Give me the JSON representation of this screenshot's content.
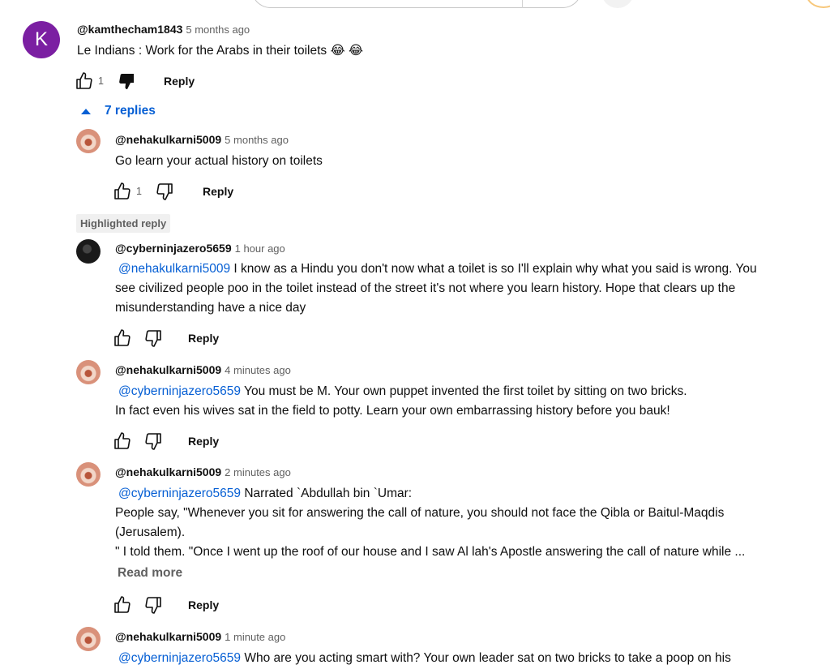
{
  "top_comment": {
    "avatar_letter": "K",
    "handle": "@kamthecham1843",
    "time": "5 months ago",
    "text": "Le Indians : Work for the Arabs in their toilets 😂 😂",
    "likes": "1",
    "reply_label": "Reply"
  },
  "replies_toggle": "7 replies",
  "highlight_label": "Highlighted reply",
  "replies": [
    {
      "handle": "@nehakulkarni5009",
      "time": "5 months ago",
      "lines": [
        "Go learn your actual history on toilets"
      ],
      "likes": "1",
      "reply_label": "Reply"
    },
    {
      "handle": "@cyberninjazero5659",
      "time": "1 hour ago",
      "mention": "@nehakulkarni5009",
      "lines": [
        " I know as a Hindu you don't now what a toilet is so I'll explain why what you said is wrong. You",
        "see civilized people poo in the toilet instead of the street it's not where you learn history. Hope that clears up the",
        "misunderstanding have a nice day"
      ],
      "reply_label": "Reply"
    },
    {
      "handle": "@nehakulkarni5009",
      "time": "4 minutes ago",
      "mention": "@cyberninjazero5659",
      "lines": [
        "  You must be M. Your own puppet invented the first toilet by sitting on two bricks.",
        "In fact even his wives sat in the field to potty. Learn your own embarrassing history before you bauk!"
      ],
      "reply_label": "Reply"
    },
    {
      "handle": "@nehakulkarni5009",
      "time": "2 minutes ago",
      "mention": "@cyberninjazero5659",
      "lines": [
        "  Narrated `Abdullah bin `Umar:",
        "People say, \"Whenever you sit for answering the call of nature, you should not face the Qibla or Baitul-Maqdis",
        "(Jerusalem).",
        "\" I told them. \"Once I went up the roof of our house and I saw Al lah's Apostle answering the call of nature while ..."
      ],
      "read_more": "Read more",
      "reply_label": "Reply"
    },
    {
      "handle": "@nehakulkarni5009",
      "time": "1 minute ago",
      "mention": "@cyberninjazero5659",
      "lines": [
        "  Who are you acting smart with? Your own leader sat on two bricks to take a poop on his"
      ]
    }
  ],
  "colors": {
    "link": "#065fd4",
    "avatar_k": "#7b1fa2",
    "secondary": "#606060"
  }
}
